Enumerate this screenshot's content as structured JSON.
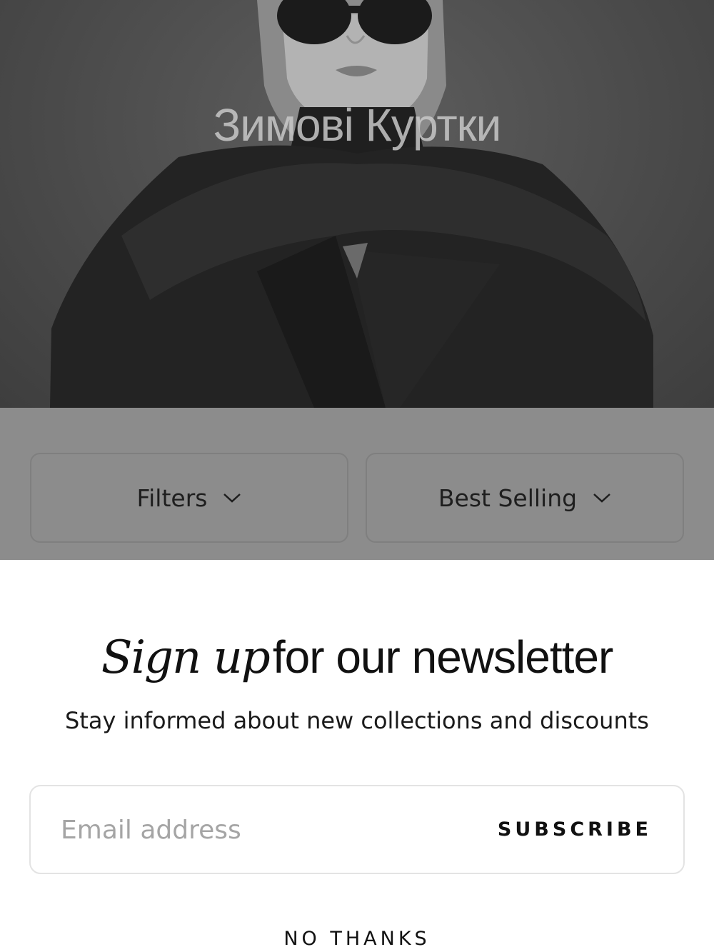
{
  "hero": {
    "title": "Зимові Куртки",
    "image": "woman-in-black-coat-and-sunglasses"
  },
  "toolbar": {
    "filters_label": "Filters",
    "sort_label": "Best Selling",
    "icons": [
      "chevron-down-icon",
      "chevron-down-icon"
    ]
  },
  "newsletter": {
    "headline_script": "Sign up",
    "headline_rest": "for our newsletter",
    "subtitle": "Stay informed about new collections and discounts",
    "email_placeholder": "Email address",
    "subscribe_label": "SUBSCRIBE",
    "dismiss_label": "NO THANKS"
  },
  "colors": {
    "overlay": "#8c8c8c",
    "text": "#111111",
    "placeholder": "#a5a5a5",
    "input_border": "#e3e3e3"
  }
}
